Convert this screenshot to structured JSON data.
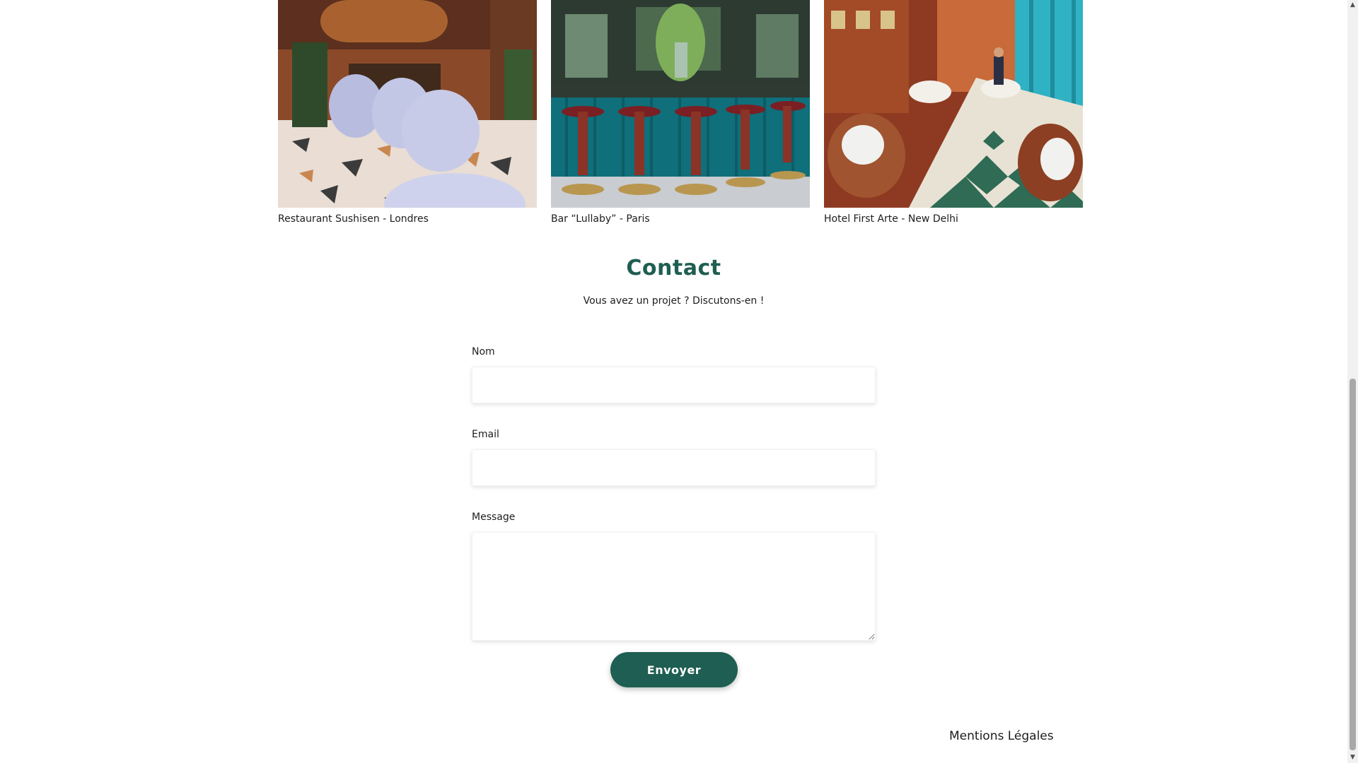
{
  "gallery": {
    "items": [
      {
        "caption": "Restaurant Sushisen - Londres",
        "image": "restaurant-interior-photo"
      },
      {
        "caption": "Bar “Lullaby” - Paris",
        "image": "bar-counter-photo"
      },
      {
        "caption": "Hotel First Arte - New Delhi",
        "image": "hotel-dining-hall-photo"
      }
    ]
  },
  "contact": {
    "title": "Contact",
    "subtitle": "Vous avez un projet ? Discutons-en !",
    "fields": {
      "name_label": "Nom",
      "name_value": "",
      "email_label": "Email",
      "email_value": "",
      "message_label": "Message",
      "message_value": ""
    },
    "submit_label": "Envoyer"
  },
  "footer": {
    "legal_label": "Mentions Légales"
  },
  "colors": {
    "brand_green": "#1f5e52",
    "text": "#1d1d1d",
    "background": "#ffffff"
  },
  "icons": {
    "scroll_up": "scroll-up-arrow-icon",
    "scroll_down": "scroll-down-arrow-icon"
  }
}
